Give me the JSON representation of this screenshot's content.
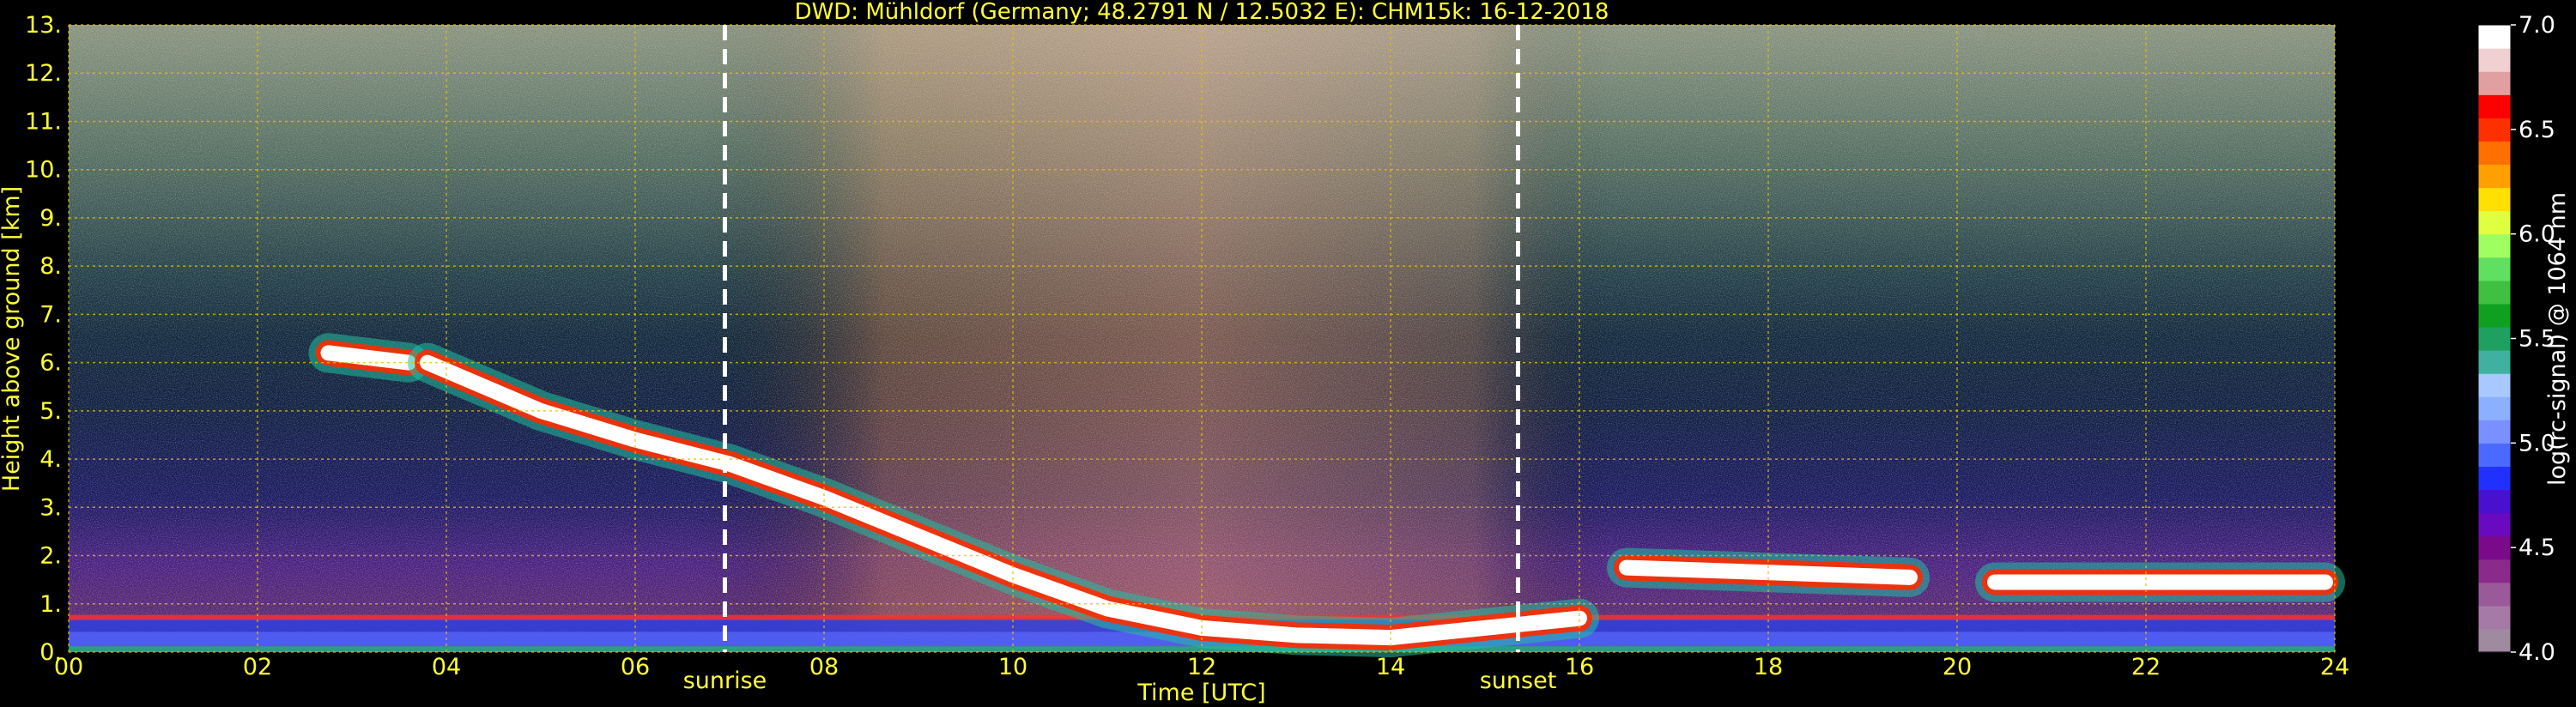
{
  "chart_data": {
    "type": "heatmap",
    "title": "DWD: Mühldorf (Germany; 48.2791 N / 12.5032 E):    CHM15k: 16-12-2018",
    "xlabel": "Time [UTC]",
    "ylabel": "Height above ground [km]",
    "xlim": [
      0,
      24
    ],
    "ylim": [
      0,
      13
    ],
    "x_ticks": [
      "00",
      "02",
      "04",
      "06",
      "08",
      "10",
      "12",
      "14",
      "16",
      "18",
      "20",
      "22",
      "24"
    ],
    "y_ticks": [
      "0.",
      "1.",
      "2.",
      "3.",
      "4.",
      "5.",
      "6.",
      "7.",
      "8.",
      "9.",
      "10.",
      "11.",
      "12.",
      "13."
    ],
    "grid": true,
    "annotations": [
      {
        "label": "sunrise",
        "x": 6.95
      },
      {
        "label": "sunset",
        "x": 15.35
      }
    ],
    "colorbar": {
      "label": "log(rc-signal) @ 1064 nm",
      "range": [
        4.0,
        7.0
      ],
      "ticks": [
        "4.0",
        "4.5",
        "5.0",
        "5.5",
        "6.0",
        "6.5",
        "7.0"
      ],
      "colors": [
        "#a08aa0",
        "#a67aa6",
        "#9a5a9a",
        "#8a2a8a",
        "#7a0a8a",
        "#6a0ac0",
        "#4a10d0",
        "#2030ff",
        "#4a6aff",
        "#7a90ff",
        "#8ab0ff",
        "#a8c8ff",
        "#40b0a0",
        "#20a060",
        "#10a020",
        "#40c040",
        "#60e060",
        "#a0ff60",
        "#e0ff40",
        "#ffe000",
        "#ffa000",
        "#ff7000",
        "#ff3000",
        "#ff0000",
        "#e0a0a0",
        "#f0d0d0",
        "#ffffff"
      ]
    },
    "cloud_layers": [
      {
        "name": "elevated-cloud-a",
        "points": [
          [
            2.75,
            6.2
          ],
          [
            3.6,
            6.0
          ]
        ]
      },
      {
        "name": "descending-cloud",
        "points": [
          [
            3.8,
            6.0
          ],
          [
            5.0,
            5.0
          ],
          [
            6.0,
            4.4
          ],
          [
            7.0,
            3.9
          ],
          [
            8.0,
            3.2
          ],
          [
            9.0,
            2.4
          ],
          [
            10.0,
            1.6
          ],
          [
            11.0,
            0.9
          ],
          [
            12.0,
            0.5
          ],
          [
            13.0,
            0.35
          ],
          [
            14.0,
            0.3
          ],
          [
            15.0,
            0.5
          ],
          [
            16.0,
            0.7
          ]
        ]
      },
      {
        "name": "low-layer",
        "points": [
          [
            16.5,
            1.75
          ],
          [
            19.5,
            1.55
          ]
        ]
      },
      {
        "name": "low-layer-2",
        "points": [
          [
            20.4,
            1.45
          ],
          [
            23.9,
            1.45
          ]
        ]
      }
    ],
    "boundary_layer_top_km": 0.7
  }
}
